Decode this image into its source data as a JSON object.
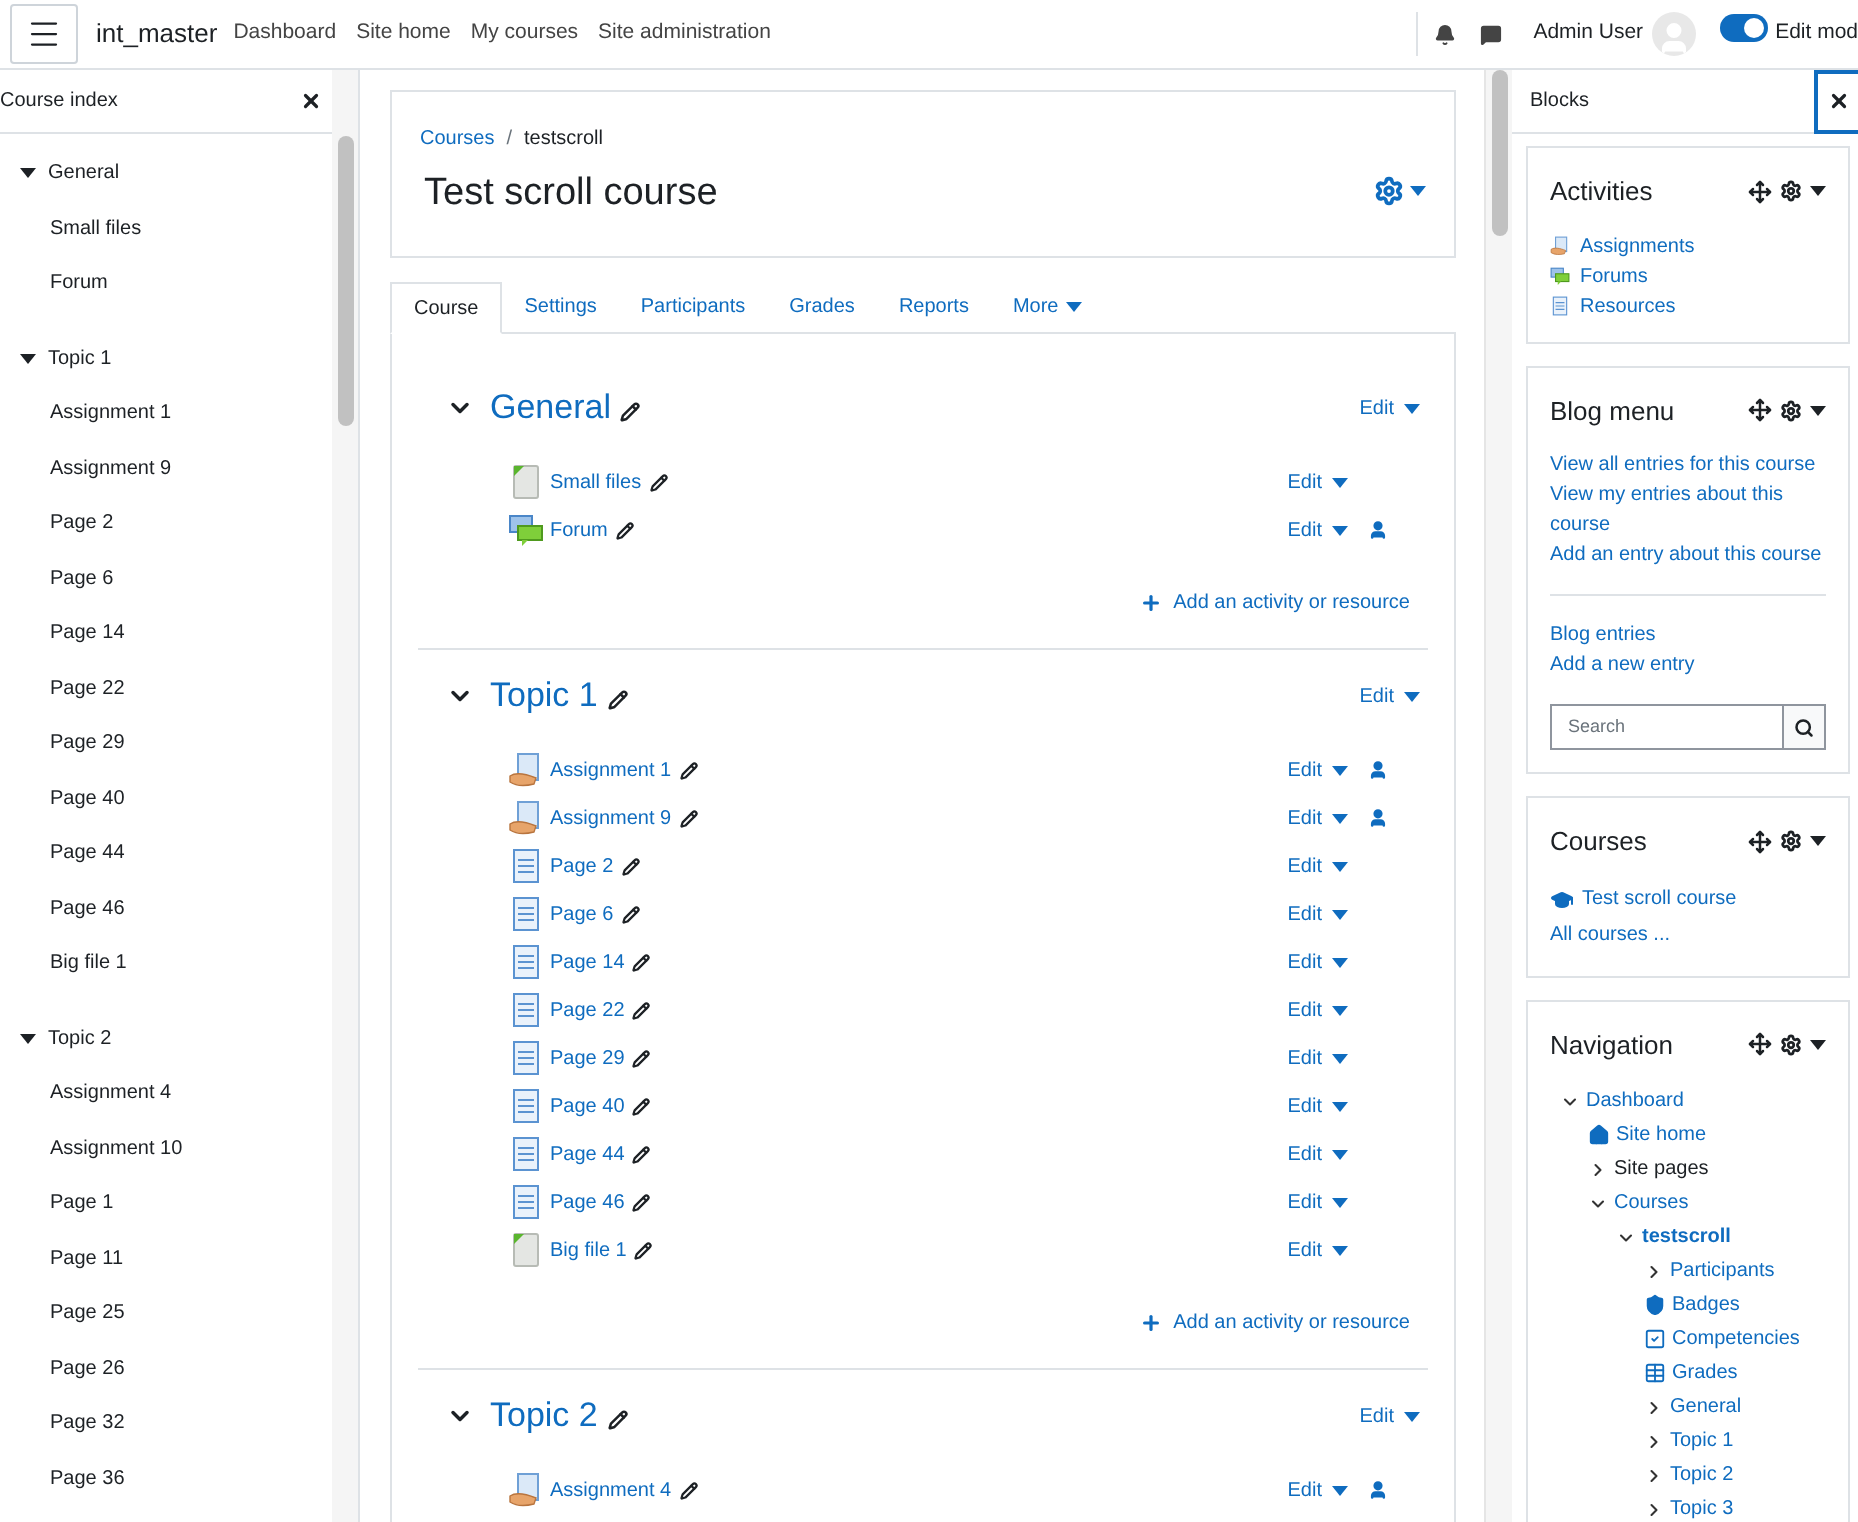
{
  "topbar": {
    "site_name": "int_master",
    "nav": [
      "Dashboard",
      "Site home",
      "My courses",
      "Site administration"
    ],
    "user_name": "Admin User",
    "edit_mode": {
      "label": "Edit mod",
      "on": true
    }
  },
  "course_index": {
    "title": "Course index",
    "sections": [
      {
        "name": "General",
        "expanded": true,
        "items": [
          "Small files",
          "Forum"
        ]
      },
      {
        "name": "Topic 1",
        "expanded": true,
        "items": [
          "Assignment 1",
          "Assignment 9",
          "Page 2",
          "Page 6",
          "Page 14",
          "Page 22",
          "Page 29",
          "Page 40",
          "Page 44",
          "Page 46",
          "Big file 1"
        ]
      },
      {
        "name": "Topic 2",
        "expanded": true,
        "items": [
          "Assignment 4",
          "Assignment 10",
          "Page 1",
          "Page 11",
          "Page 25",
          "Page 26",
          "Page 32",
          "Page 36"
        ]
      }
    ]
  },
  "header": {
    "separator": "/",
    "breadcrumb": [
      {
        "label": "Courses",
        "link": true
      },
      {
        "label": "testscroll",
        "link": false
      }
    ],
    "title": "Test scroll course"
  },
  "tabs": [
    {
      "label": "Course",
      "selected": true,
      "kind": "tab"
    },
    {
      "label": "Settings",
      "selected": false,
      "kind": "tab"
    },
    {
      "label": "Participants",
      "selected": false,
      "kind": "tab"
    },
    {
      "label": "Grades",
      "selected": false,
      "kind": "tab"
    },
    {
      "label": "Reports",
      "selected": false,
      "kind": "tab"
    },
    {
      "label": "More",
      "selected": false,
      "kind": "menu"
    }
  ],
  "sections": [
    {
      "name": "General",
      "edit": "Edit",
      "add_label": "Add an activity or resource",
      "activities": [
        {
          "kind": "file",
          "name": "Small files",
          "edit": "Edit",
          "restricted": false
        },
        {
          "kind": "forum",
          "name": "Forum",
          "edit": "Edit",
          "restricted": true
        }
      ]
    },
    {
      "name": "Topic 1",
      "edit": "Edit",
      "add_label": "Add an activity or resource",
      "activities": [
        {
          "kind": "assign",
          "name": "Assignment 1",
          "edit": "Edit",
          "restricted": true
        },
        {
          "kind": "assign",
          "name": "Assignment 9",
          "edit": "Edit",
          "restricted": true
        },
        {
          "kind": "page",
          "name": "Page 2",
          "edit": "Edit",
          "restricted": false
        },
        {
          "kind": "page",
          "name": "Page 6",
          "edit": "Edit",
          "restricted": false
        },
        {
          "kind": "page",
          "name": "Page 14",
          "edit": "Edit",
          "restricted": false
        },
        {
          "kind": "page",
          "name": "Page 22",
          "edit": "Edit",
          "restricted": false
        },
        {
          "kind": "page",
          "name": "Page 29",
          "edit": "Edit",
          "restricted": false
        },
        {
          "kind": "page",
          "name": "Page 40",
          "edit": "Edit",
          "restricted": false
        },
        {
          "kind": "page",
          "name": "Page 44",
          "edit": "Edit",
          "restricted": false
        },
        {
          "kind": "page",
          "name": "Page 46",
          "edit": "Edit",
          "restricted": false
        },
        {
          "kind": "file",
          "name": "Big file 1",
          "edit": "Edit",
          "restricted": false
        }
      ]
    },
    {
      "name": "Topic 2",
      "edit": "Edit",
      "activities": [
        {
          "kind": "assign",
          "name": "Assignment 4",
          "edit": "Edit",
          "restricted": true
        }
      ]
    }
  ],
  "blocks": {
    "title": "Blocks",
    "activities_block": {
      "title": "Activities",
      "links": [
        {
          "kind": "assign",
          "label": "Assignments"
        },
        {
          "kind": "forum",
          "label": "Forums"
        },
        {
          "kind": "page",
          "label": "Resources"
        }
      ]
    },
    "blog_block": {
      "title": "Blog menu",
      "links": [
        "View all entries for this course",
        "View my entries about this course",
        "Add an entry about this course"
      ],
      "links_2": [
        "Blog entries",
        "Add a new entry"
      ],
      "search_placeholder": "Search"
    },
    "courses_block": {
      "title": "Courses",
      "links": [
        {
          "kind": "course",
          "label": "Test scroll course"
        },
        {
          "kind": "plain",
          "label": "All courses ..."
        }
      ]
    },
    "navigation_block": {
      "title": "Navigation",
      "tree": [
        {
          "kind": "branch",
          "label": "Dashboard",
          "expanded": true,
          "link": true,
          "current": false,
          "children": [
            {
              "kind": "home",
              "label": "Site home",
              "link": true,
              "current": false
            },
            {
              "kind": "branch",
              "label": "Site pages",
              "expanded": false,
              "link": false,
              "current": false
            },
            {
              "kind": "branch",
              "label": "Courses",
              "expanded": true,
              "link": true,
              "current": false,
              "children": [
                {
                  "kind": "branch",
                  "label": "testscroll",
                  "expanded": true,
                  "link": true,
                  "current": true,
                  "children": [
                    {
                      "kind": "branch",
                      "label": "Participants",
                      "expanded": false,
                      "link": true,
                      "current": false
                    },
                    {
                      "kind": "badge",
                      "label": "Badges",
                      "link": true,
                      "current": false
                    },
                    {
                      "kind": "competency",
                      "label": "Competencies",
                      "link": true,
                      "current": false
                    },
                    {
                      "kind": "grades",
                      "label": "Grades",
                      "link": true,
                      "current": false
                    },
                    {
                      "kind": "branch",
                      "label": "General",
                      "expanded": false,
                      "link": true,
                      "current": false
                    },
                    {
                      "kind": "branch",
                      "label": "Topic 1",
                      "expanded": false,
                      "link": true,
                      "current": false
                    },
                    {
                      "kind": "branch",
                      "label": "Topic 2",
                      "expanded": false,
                      "link": true,
                      "current": false
                    },
                    {
                      "kind": "branch",
                      "label": "Topic 3",
                      "expanded": false,
                      "link": true,
                      "current": false
                    }
                  ]
                }
              ]
            }
          ]
        }
      ]
    }
  }
}
